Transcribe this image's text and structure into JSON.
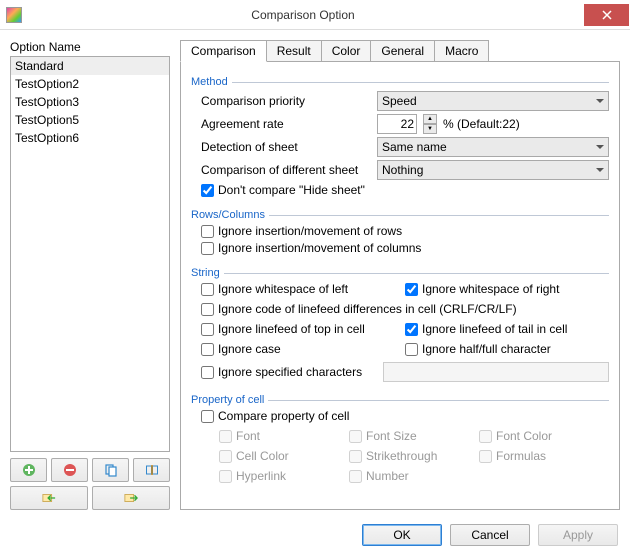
{
  "window": {
    "title": "Comparison Option"
  },
  "leftpane": {
    "label": "Option Name",
    "items": [
      "Standard",
      "TestOption2",
      "TestOption3",
      "TestOption5",
      "TestOption6"
    ],
    "selected_index": 0
  },
  "tabs": {
    "items": [
      "Comparison",
      "Result",
      "Color",
      "General",
      "Macro"
    ],
    "active_index": 0
  },
  "method": {
    "legend": "Method",
    "priority_label": "Comparison priority",
    "priority_value": "Speed",
    "rate_label": "Agreement rate",
    "rate_value": "22",
    "rate_suffix": "% (Default:22)",
    "detection_label": "Detection of sheet",
    "detection_value": "Same name",
    "diff_label": "Comparison of different sheet",
    "diff_value": "Nothing",
    "hide_label": "Don't compare \"Hide sheet\"",
    "hide_checked": true
  },
  "rowscols": {
    "legend": "Rows/Columns",
    "ignore_rows": "Ignore insertion/movement of rows",
    "ignore_rows_checked": false,
    "ignore_cols": "Ignore insertion/movement of columns",
    "ignore_cols_checked": false
  },
  "string": {
    "legend": "String",
    "ws_left": "Ignore whitespace of left",
    "ws_left_checked": false,
    "ws_right": "Ignore whitespace of right",
    "ws_right_checked": true,
    "lf_code": "Ignore code of linefeed differences in cell (CRLF/CR/LF)",
    "lf_code_checked": false,
    "lf_top": "Ignore linefeed of top in cell",
    "lf_top_checked": false,
    "lf_tail": "Ignore linefeed of tail in cell",
    "lf_tail_checked": true,
    "case": "Ignore case",
    "case_checked": false,
    "halffull": "Ignore half/full character",
    "halffull_checked": false,
    "spec": "Ignore specified characters",
    "spec_checked": false,
    "spec_value": ""
  },
  "prop": {
    "legend": "Property of cell",
    "compare": "Compare property of cell",
    "compare_checked": false,
    "font": "Font",
    "fontsize": "Font Size",
    "fontcolor": "Font Color",
    "cellcolor": "Cell Color",
    "strike": "Strikethrough",
    "formulas": "Formulas",
    "hyperlink": "Hyperlink",
    "number": "Number"
  },
  "buttons": {
    "ok": "OK",
    "cancel": "Cancel",
    "apply": "Apply"
  }
}
